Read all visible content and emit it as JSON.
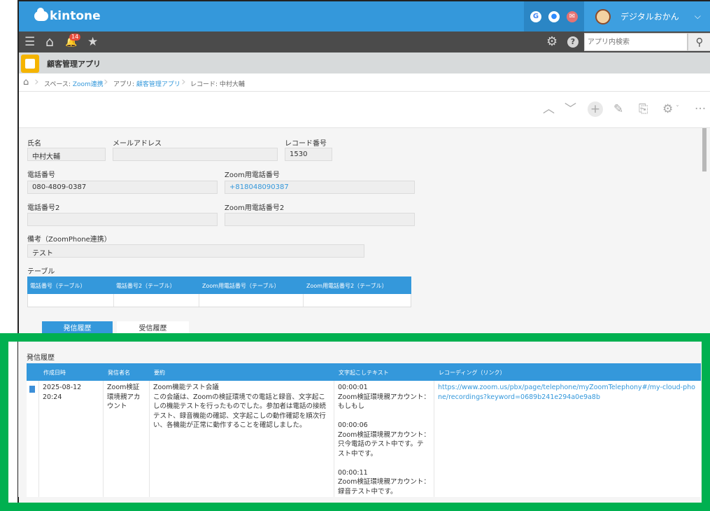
{
  "header": {
    "logo_text": "kintone",
    "apps": [
      {
        "name": "google",
        "glyph": "G"
      },
      {
        "name": "zoom",
        "glyph": "●"
      },
      {
        "name": "mail",
        "glyph": "✉"
      }
    ],
    "user_name": "デジタルおかん",
    "user_chevron": "⌵"
  },
  "toolbar": {
    "menu_glyph": "☰",
    "home_glyph": "⌂",
    "bell_glyph": "🔔",
    "notifications": "14",
    "star_glyph": "★",
    "gear_glyph": "⚙",
    "help_glyph": "?",
    "search_placeholder": "アプリ内検索",
    "search_glyph": "⚲"
  },
  "app": {
    "title": "顧客管理アプリ"
  },
  "breadcrumb": {
    "home_glyph": "⌂",
    "space_label": "スペース: ",
    "space_name": "Zoom連携",
    "app_label": "アプリ: ",
    "app_name": "顧客管理アプリ",
    "record_label": "レコード: 中村大輔",
    "separator": "›"
  },
  "actions": {
    "up": "︿",
    "down": "﹀",
    "add": "+",
    "edit": "✎",
    "copy": "⎘",
    "settings": "⚙",
    "settings_chev": "ˇ",
    "more": "···"
  },
  "form": {
    "name_label": "氏名",
    "name_value": "中村大輔",
    "email_label": "メールアドレス",
    "email_value": "",
    "record_no_label": "レコード番号",
    "record_no_value": "1530",
    "phone_label": "電話番号",
    "phone_value": "080-4809-0387",
    "zoom_phone_label": "Zoom用電話番号",
    "zoom_phone_value": "+818048090387",
    "phone2_label": "電話番号2",
    "phone2_value": "",
    "zoom_phone2_label": "Zoom用電話番号2",
    "zoom_phone2_value": "",
    "memo_label": "備考（ZoomPhone連携）",
    "memo_value": "テスト",
    "table_label": "テーブル",
    "table_headers": [
      "電話番号（テーブル）",
      "電話番号2（テーブル）",
      "Zoom用電話番号（テーブル）",
      "Zoom用電話番号2（テーブル）"
    ]
  },
  "tabs": {
    "outgoing": "発信履歴",
    "incoming": "受信履歴"
  },
  "history": {
    "title": "発信履歴",
    "headers": [
      "作成日時",
      "発信者名",
      "要約",
      "文字起こしテキスト",
      "レコーディング（リンク）"
    ],
    "row": {
      "created": "2025-08-12 20:24",
      "caller": "Zoom検証環境親アカウント",
      "summary": "Zoom機能テスト会議\nこの会議は、Zoomの検証環境での電話と録音、文字起こしの機能テストを行ったものでした。参加者は電話の接続テスト、録音機能の確認、文字起こしの動作確認を順次行い、各機能が正常に動作することを確認しました。",
      "transcript": "00:00:01\nZoom検証環境親アカウント：もしもし\n\n00:00:06\nZoom検証環境親アカウント：只今電話のテスト中です。テスト中です。\n\n00:00:11\nZoom検証環境親アカウント：録音テスト中です。",
      "recording": "https://www.zoom.us/pbx/page/telephone/myZoomTelephony#/my-cloud-phone/recordings?keyword=0689b241e294a0e9a8b"
    }
  }
}
